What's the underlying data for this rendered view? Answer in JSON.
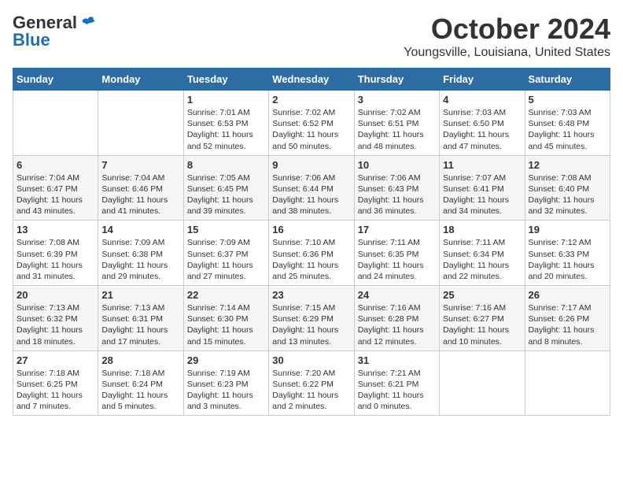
{
  "header": {
    "logo_general": "General",
    "logo_blue": "Blue",
    "title": "October 2024",
    "subtitle": "Youngsville, Louisiana, United States"
  },
  "days_of_week": [
    "Sunday",
    "Monday",
    "Tuesday",
    "Wednesday",
    "Thursday",
    "Friday",
    "Saturday"
  ],
  "weeks": [
    [
      {
        "day": "",
        "info": ""
      },
      {
        "day": "",
        "info": ""
      },
      {
        "day": "1",
        "info": "Sunrise: 7:01 AM\nSunset: 6:53 PM\nDaylight: 11 hours and 52 minutes."
      },
      {
        "day": "2",
        "info": "Sunrise: 7:02 AM\nSunset: 6:52 PM\nDaylight: 11 hours and 50 minutes."
      },
      {
        "day": "3",
        "info": "Sunrise: 7:02 AM\nSunset: 6:51 PM\nDaylight: 11 hours and 48 minutes."
      },
      {
        "day": "4",
        "info": "Sunrise: 7:03 AM\nSunset: 6:50 PM\nDaylight: 11 hours and 47 minutes."
      },
      {
        "day": "5",
        "info": "Sunrise: 7:03 AM\nSunset: 6:48 PM\nDaylight: 11 hours and 45 minutes."
      }
    ],
    [
      {
        "day": "6",
        "info": "Sunrise: 7:04 AM\nSunset: 6:47 PM\nDaylight: 11 hours and 43 minutes."
      },
      {
        "day": "7",
        "info": "Sunrise: 7:04 AM\nSunset: 6:46 PM\nDaylight: 11 hours and 41 minutes."
      },
      {
        "day": "8",
        "info": "Sunrise: 7:05 AM\nSunset: 6:45 PM\nDaylight: 11 hours and 39 minutes."
      },
      {
        "day": "9",
        "info": "Sunrise: 7:06 AM\nSunset: 6:44 PM\nDaylight: 11 hours and 38 minutes."
      },
      {
        "day": "10",
        "info": "Sunrise: 7:06 AM\nSunset: 6:43 PM\nDaylight: 11 hours and 36 minutes."
      },
      {
        "day": "11",
        "info": "Sunrise: 7:07 AM\nSunset: 6:41 PM\nDaylight: 11 hours and 34 minutes."
      },
      {
        "day": "12",
        "info": "Sunrise: 7:08 AM\nSunset: 6:40 PM\nDaylight: 11 hours and 32 minutes."
      }
    ],
    [
      {
        "day": "13",
        "info": "Sunrise: 7:08 AM\nSunset: 6:39 PM\nDaylight: 11 hours and 31 minutes."
      },
      {
        "day": "14",
        "info": "Sunrise: 7:09 AM\nSunset: 6:38 PM\nDaylight: 11 hours and 29 minutes."
      },
      {
        "day": "15",
        "info": "Sunrise: 7:09 AM\nSunset: 6:37 PM\nDaylight: 11 hours and 27 minutes."
      },
      {
        "day": "16",
        "info": "Sunrise: 7:10 AM\nSunset: 6:36 PM\nDaylight: 11 hours and 25 minutes."
      },
      {
        "day": "17",
        "info": "Sunrise: 7:11 AM\nSunset: 6:35 PM\nDaylight: 11 hours and 24 minutes."
      },
      {
        "day": "18",
        "info": "Sunrise: 7:11 AM\nSunset: 6:34 PM\nDaylight: 11 hours and 22 minutes."
      },
      {
        "day": "19",
        "info": "Sunrise: 7:12 AM\nSunset: 6:33 PM\nDaylight: 11 hours and 20 minutes."
      }
    ],
    [
      {
        "day": "20",
        "info": "Sunrise: 7:13 AM\nSunset: 6:32 PM\nDaylight: 11 hours and 18 minutes."
      },
      {
        "day": "21",
        "info": "Sunrise: 7:13 AM\nSunset: 6:31 PM\nDaylight: 11 hours and 17 minutes."
      },
      {
        "day": "22",
        "info": "Sunrise: 7:14 AM\nSunset: 6:30 PM\nDaylight: 11 hours and 15 minutes."
      },
      {
        "day": "23",
        "info": "Sunrise: 7:15 AM\nSunset: 6:29 PM\nDaylight: 11 hours and 13 minutes."
      },
      {
        "day": "24",
        "info": "Sunrise: 7:16 AM\nSunset: 6:28 PM\nDaylight: 11 hours and 12 minutes."
      },
      {
        "day": "25",
        "info": "Sunrise: 7:16 AM\nSunset: 6:27 PM\nDaylight: 11 hours and 10 minutes."
      },
      {
        "day": "26",
        "info": "Sunrise: 7:17 AM\nSunset: 6:26 PM\nDaylight: 11 hours and 8 minutes."
      }
    ],
    [
      {
        "day": "27",
        "info": "Sunrise: 7:18 AM\nSunset: 6:25 PM\nDaylight: 11 hours and 7 minutes."
      },
      {
        "day": "28",
        "info": "Sunrise: 7:18 AM\nSunset: 6:24 PM\nDaylight: 11 hours and 5 minutes."
      },
      {
        "day": "29",
        "info": "Sunrise: 7:19 AM\nSunset: 6:23 PM\nDaylight: 11 hours and 3 minutes."
      },
      {
        "day": "30",
        "info": "Sunrise: 7:20 AM\nSunset: 6:22 PM\nDaylight: 11 hours and 2 minutes."
      },
      {
        "day": "31",
        "info": "Sunrise: 7:21 AM\nSunset: 6:21 PM\nDaylight: 11 hours and 0 minutes."
      },
      {
        "day": "",
        "info": ""
      },
      {
        "day": "",
        "info": ""
      }
    ]
  ]
}
